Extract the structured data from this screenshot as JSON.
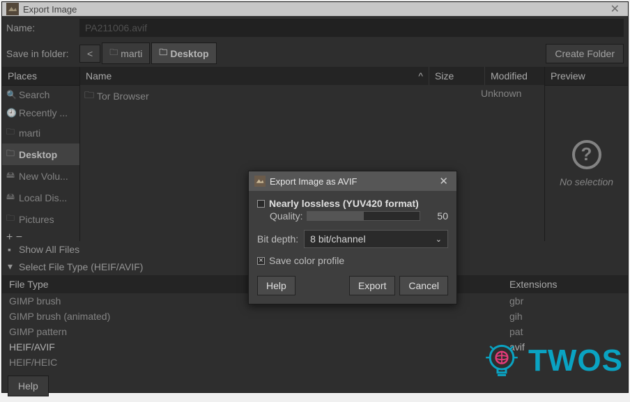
{
  "window": {
    "title": "Export Image",
    "name_label": "Name:",
    "name_value": "PA211006.avif",
    "save_in_folder_label": "Save in folder:",
    "back_arrow": "<",
    "path": [
      {
        "label": "marti",
        "selected": false
      },
      {
        "label": "Desktop",
        "selected": true
      }
    ],
    "create_folder_label": "Create Folder"
  },
  "places": {
    "header": "Places",
    "items": [
      {
        "icon": "search-icon",
        "label": "Search"
      },
      {
        "icon": "clock-icon",
        "label": "Recently ..."
      },
      {
        "icon": "folder-icon",
        "label": "marti"
      },
      {
        "icon": "folder-icon",
        "label": "Desktop",
        "selected": true
      },
      {
        "icon": "drive-icon",
        "label": "New Volu..."
      },
      {
        "icon": "drive-icon",
        "label": "Local Dis..."
      },
      {
        "icon": "folder-icon",
        "label": "Pictures"
      }
    ],
    "add": "+",
    "remove": "−"
  },
  "files": {
    "col_name": "Name",
    "col_size": "Size",
    "col_modified": "Modified",
    "sort_indicator": "^",
    "rows": [
      {
        "icon": "folder-icon",
        "name": "Tor Browser",
        "size": "",
        "modified": "Unknown"
      }
    ]
  },
  "preview": {
    "header": "Preview",
    "message": "No selection"
  },
  "options": {
    "show_all": "Show All Files",
    "select_file_type": "Select File Type (HEIF/AVIF)"
  },
  "file_types": {
    "file_type_header": "File Type",
    "extensions_header": "Extensions",
    "rows": [
      {
        "name": "GIMP brush",
        "ext": "gbr"
      },
      {
        "name": "GIMP brush (animated)",
        "ext": "gih"
      },
      {
        "name": "GIMP pattern",
        "ext": "pat"
      },
      {
        "name": "HEIF/AVIF",
        "ext": "avif",
        "selected": true
      },
      {
        "name": "HEIF/HEIC",
        "ext": ""
      }
    ]
  },
  "bottom": {
    "help": "Help"
  },
  "modal": {
    "title": "Export Image as AVIF",
    "nearly_lossless": "Nearly lossless (YUV420 format)",
    "quality_label": "Quality:",
    "quality_value": "50",
    "bit_depth_label": "Bit depth:",
    "bit_depth_value": "8 bit/channel",
    "save_color_profile": "Save color profile",
    "help": "Help",
    "export": "Export",
    "cancel": "Cancel"
  },
  "watermark": {
    "text": "TWOS"
  }
}
